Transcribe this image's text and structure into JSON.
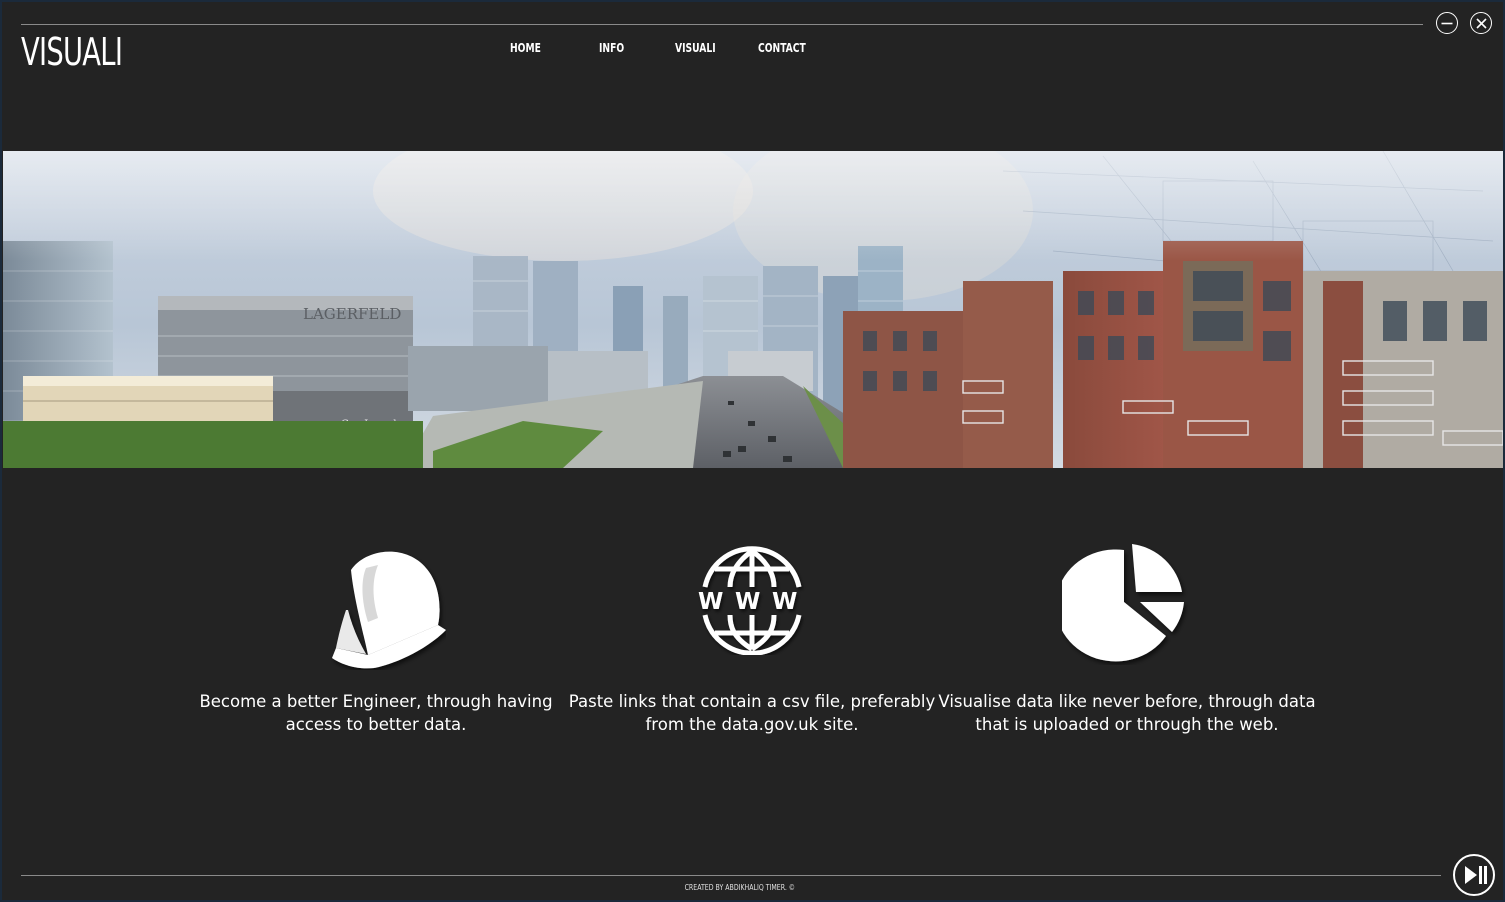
{
  "app": {
    "logo": "VISUALI"
  },
  "nav": {
    "items": [
      {
        "label": "HOME"
      },
      {
        "label": "INFO"
      },
      {
        "label": "VISUALI"
      },
      {
        "label": "CONTACT"
      }
    ]
  },
  "window_controls": {
    "minimize_icon": "minimize-icon",
    "close_icon": "close-icon"
  },
  "hero": {
    "image_subject": "city-skyline-rendering",
    "visible_signs": [
      "LAGERFELD",
      "Guy Laroche"
    ]
  },
  "features": [
    {
      "icon": "hard-hat-icon",
      "text": "Become a better Engineer, through having access to better data."
    },
    {
      "icon": "www-globe-icon",
      "text": "Paste links that contain a csv file, preferably from the data.gov.uk site."
    },
    {
      "icon": "pie-chart-icon",
      "text": "Visualise data like never before, through data that is uploaded or through the web."
    }
  ],
  "footer": {
    "credit": "CREATED BY ABDIKHALIQ TIMER. ©",
    "media_button_icon": "play-pause-icon"
  },
  "colors": {
    "background": "#232323",
    "text": "#ffffff",
    "rule": "#8a8a8a"
  }
}
